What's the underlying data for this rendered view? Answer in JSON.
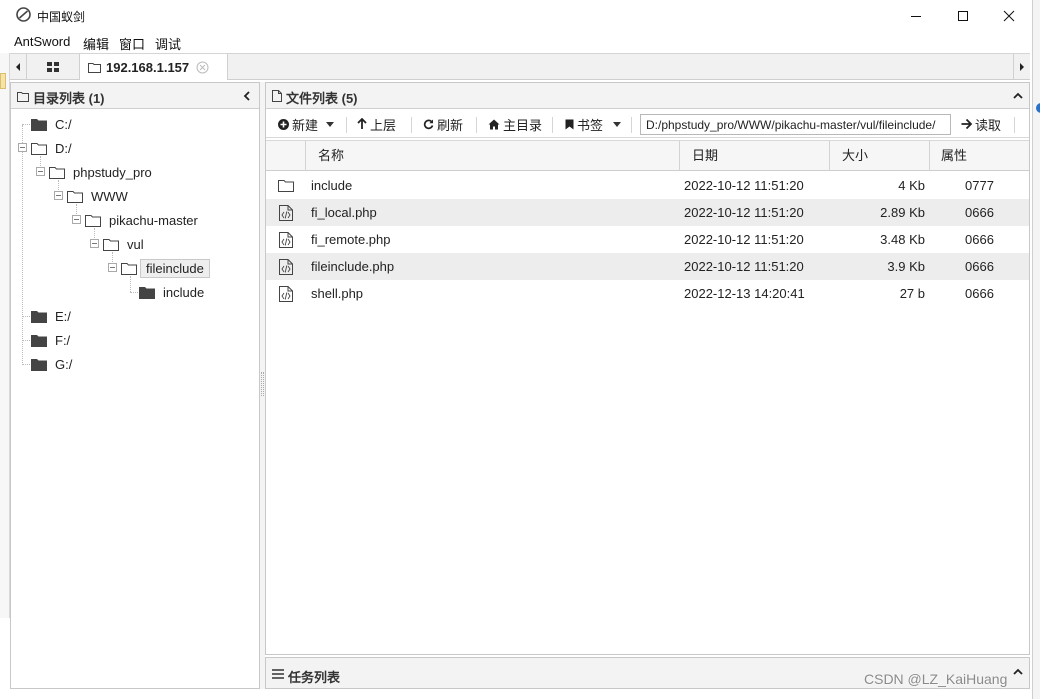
{
  "window": {
    "title": "中国蚁剑",
    "controls": [
      "minimize",
      "maximize",
      "close"
    ]
  },
  "menu": [
    "AntSword",
    "编辑",
    "窗口",
    "调试"
  ],
  "tabs": {
    "active": "192.168.1.157"
  },
  "dir_panel": {
    "title": "目录列表 (1)",
    "tree": [
      {
        "label": "C:/",
        "kind": "drive"
      },
      {
        "label": "D:/",
        "kind": "drive-open"
      },
      {
        "label": "phpstudy_pro",
        "kind": "folder-open"
      },
      {
        "label": "WWW",
        "kind": "folder-open"
      },
      {
        "label": "pikachu-master",
        "kind": "folder-open"
      },
      {
        "label": "vul",
        "kind": "folder-open"
      },
      {
        "label": "fileinclude",
        "kind": "folder-open-selected"
      },
      {
        "label": "include",
        "kind": "folder-closed"
      },
      {
        "label": "E:/",
        "kind": "drive"
      },
      {
        "label": "F:/",
        "kind": "drive"
      },
      {
        "label": "G:/",
        "kind": "drive"
      }
    ]
  },
  "file_panel": {
    "title": "文件列表 (5)",
    "toolbar": {
      "new": "新建",
      "up": "上层",
      "refresh": "刷新",
      "home": "主目录",
      "bookmark": "书签",
      "path": "D:/phpstudy_pro/WWW/pikachu-master/vul/fileinclude/",
      "read": "读取"
    },
    "columns": [
      "名称",
      "日期",
      "大小",
      "属性"
    ],
    "files": [
      {
        "name": "include",
        "date": "2022-10-12 11:51:20",
        "size": "4 Kb",
        "attr": "0777",
        "icon": "folder-icon"
      },
      {
        "name": "fi_local.php",
        "date": "2022-10-12 11:51:20",
        "size": "2.89 Kb",
        "attr": "0666",
        "icon": "code-file-icon"
      },
      {
        "name": "fi_remote.php",
        "date": "2022-10-12 11:51:20",
        "size": "3.48 Kb",
        "attr": "0666",
        "icon": "code-file-icon"
      },
      {
        "name": "fileinclude.php",
        "date": "2022-10-12 11:51:20",
        "size": "3.9 Kb",
        "attr": "0666",
        "icon": "code-file-icon"
      },
      {
        "name": "shell.php",
        "date": "2022-12-13 14:20:41",
        "size": "27 b",
        "attr": "0666",
        "icon": "code-file-icon"
      }
    ]
  },
  "task_panel": {
    "title": "任务列表"
  },
  "watermark": "CSDN @LZ_KaiHuang",
  "colors": {
    "panel_header": "#f3f3f3",
    "alt_row": "#ededed",
    "border": "#c8c8c8"
  }
}
